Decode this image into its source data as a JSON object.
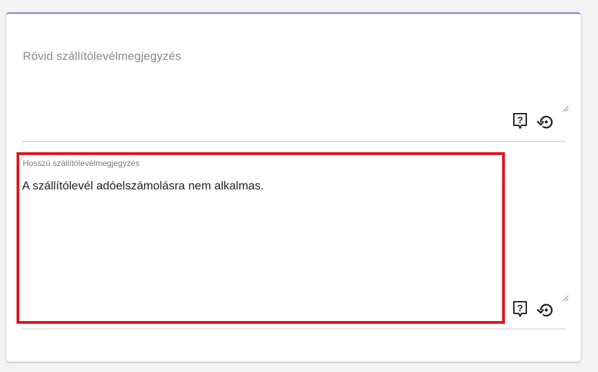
{
  "form": {
    "short_note": {
      "label": "Rövid szállítólevélmegjegyzés",
      "value": ""
    },
    "long_note": {
      "label": "Hosszú szállítólevélmegjegyzés",
      "value": "A szállítólevél adóelszámolásra nem alkalmas."
    },
    "icons": {
      "help": "help-icon",
      "reset": "reset-icon",
      "resize": "resize-grip-icon"
    }
  },
  "colors": {
    "accent": "#7b81c9",
    "highlight": "#e0141e"
  }
}
